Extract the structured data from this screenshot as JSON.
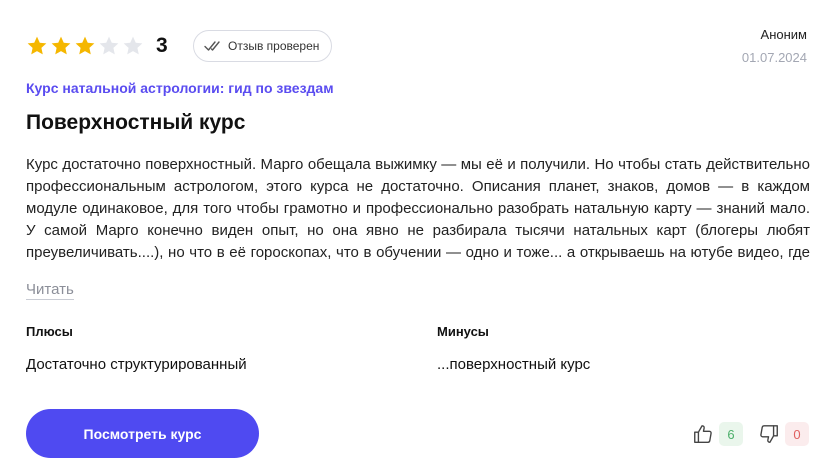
{
  "review": {
    "rating_value": 3,
    "rating_max": 5,
    "rating_label": "3",
    "verified_label": "Отзыв проверен",
    "author": "Аноним",
    "date": "01.07.2024",
    "course_name": "Курс натальной астрологии: гид по звездам",
    "title": "Поверхностный курс",
    "text": "Курс достаточно поверхностный. Марго обещала выжимку — мы её и получили. Но чтобы стать действительно профессиональным астрологом, этого курса не достаточно. Описания планет, знаков, домов — в каждом модуле одинаковое, для того чтобы грамотно и профессионально разобрать натальную карту — знаний мало. У самой Марго конечно виден опыт, но она явно не разбирала тысячи натальных карт (блогеры любят преувеличивать....), но что в её гороскопах, что в обучении — одно и тоже... а открываешь на ютубе видео, где делятся знаниями бесплатно —...",
    "read_more": "Читать",
    "pros_title": "Плюсы",
    "pros_text": "Достаточно структурированный",
    "cons_title": "Минусы",
    "cons_text": "...поверхностный курс",
    "cta_label": "Посмотреть курс",
    "likes": "6",
    "dislikes": "0"
  },
  "colors": {
    "star_filled": "#f5b700",
    "star_empty": "#e4e6eb",
    "accent": "#4f4af1",
    "course_link": "#5a4cf0"
  },
  "icons": {
    "stars": "star-icon",
    "verified": "double-check-icon",
    "like": "thumbs-up-icon",
    "dislike": "thumbs-down-icon"
  }
}
